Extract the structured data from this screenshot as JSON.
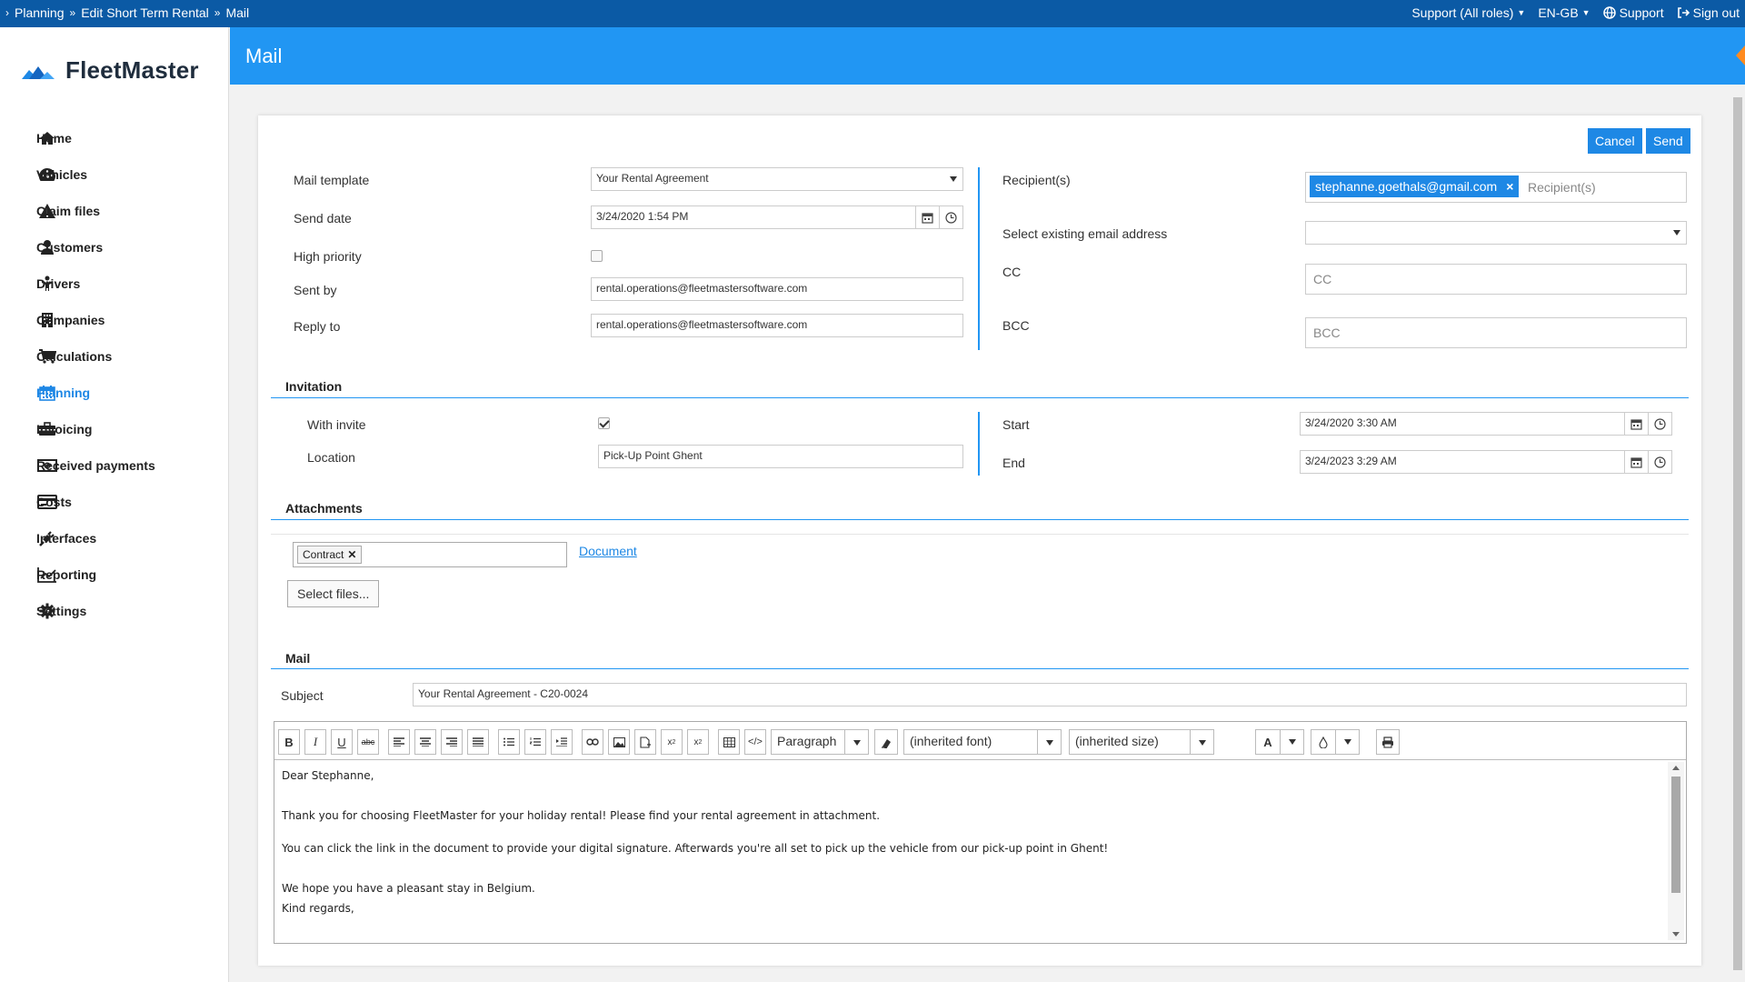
{
  "breadcrumb": [
    "Planning",
    "Edit Short Term Rental",
    "Mail"
  ],
  "topbar": {
    "support_roles": "Support (All roles)",
    "language": "EN-GB",
    "support": "Support",
    "sign_out": "Sign out"
  },
  "app": {
    "name": "FleetMaster"
  },
  "sidebar": {
    "items": [
      {
        "label": "Home",
        "icon": "home-icon"
      },
      {
        "label": "Vehicles",
        "icon": "dashboard-icon"
      },
      {
        "label": "Claim files",
        "icon": "warning-icon"
      },
      {
        "label": "Customers",
        "icon": "user-icon"
      },
      {
        "label": "Drivers",
        "icon": "driver-icon"
      },
      {
        "label": "Companies",
        "icon": "building-icon"
      },
      {
        "label": "Calculations",
        "icon": "cart-icon"
      },
      {
        "label": "Planning",
        "icon": "calendar-icon"
      },
      {
        "label": "Invoicing",
        "icon": "briefcase-icon"
      },
      {
        "label": "Received payments",
        "icon": "money-icon"
      },
      {
        "label": "Costs",
        "icon": "credit-card-icon"
      },
      {
        "label": "Interfaces",
        "icon": "plug-icon"
      },
      {
        "label": "Reporting",
        "icon": "line-chart-icon"
      },
      {
        "label": "Settings",
        "icon": "gear-icon"
      }
    ],
    "active": "Planning"
  },
  "header": {
    "title": "Mail"
  },
  "actions": {
    "cancel": "Cancel",
    "send": "Send"
  },
  "form": {
    "mail_template": {
      "label": "Mail template",
      "value": "Your Rental Agreement"
    },
    "send_date": {
      "label": "Send date",
      "value": "3/24/2020 1:54 PM"
    },
    "high_priority": {
      "label": "High priority",
      "checked": false
    },
    "sent_by": {
      "label": "Sent by",
      "value": "rental.operations@fleetmastersoftware.com"
    },
    "reply_to": {
      "label": "Reply to",
      "value": "rental.operations@fleetmastersoftware.com"
    },
    "recipients": {
      "label": "Recipient(s)",
      "chip": "stephanne.goethals@gmail.com",
      "placeholder": "Recipient(s)"
    },
    "existing_email": {
      "label": "Select existing email address",
      "value": ""
    },
    "cc": {
      "label": "CC",
      "placeholder": "CC"
    },
    "bcc": {
      "label": "BCC",
      "placeholder": "BCC"
    }
  },
  "invitation": {
    "title": "Invitation",
    "with_invite": {
      "label": "With invite",
      "checked": true
    },
    "location": {
      "label": "Location",
      "value": "Pick-Up Point Ghent"
    },
    "start": {
      "label": "Start",
      "value": "3/24/2020 3:30 AM"
    },
    "end": {
      "label": "End",
      "value": "3/24/2023 3:29 AM"
    }
  },
  "attachments": {
    "title": "Attachments",
    "tag": "Contract",
    "document_link": "Document",
    "select_files": "Select files..."
  },
  "mail": {
    "title": "Mail",
    "subject_label": "Subject",
    "subject": "Your Rental Agreement - C20-0024",
    "toolbar": {
      "format": "Paragraph",
      "font": "(inherited font)",
      "size": "(inherited size)"
    },
    "body": [
      "Dear Stephanne,",
      "",
      "Thank you for choosing FleetMaster for your holiday rental! Please find your rental agreement in attachment.",
      "",
      "You can click the link in the document to provide your digital signature. Afterwards you're all set to pick up the vehicle from our pick-up point in Ghent!",
      "",
      "We hope you have a pleasant stay in Belgium.",
      "Kind regards,"
    ]
  }
}
